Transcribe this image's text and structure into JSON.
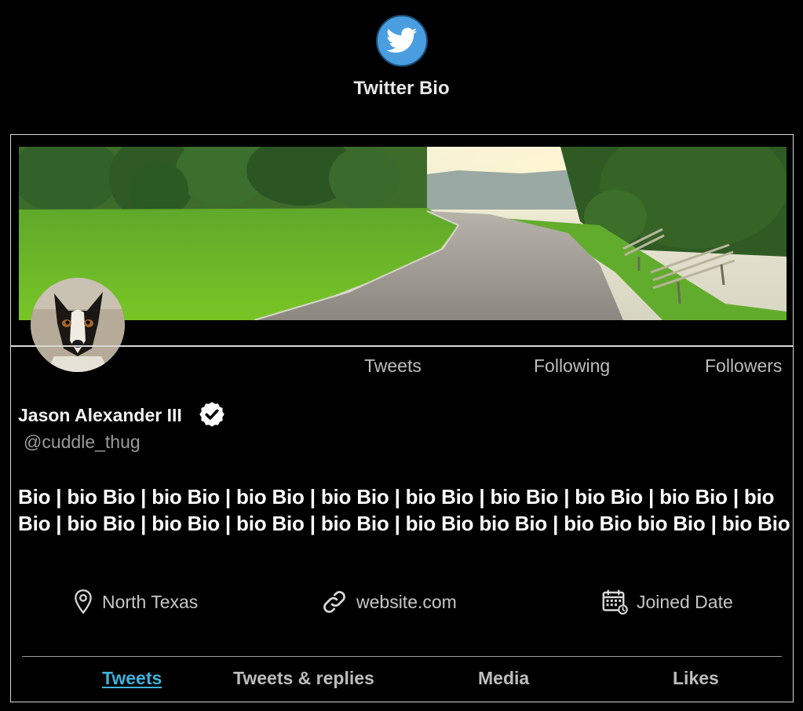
{
  "app": {
    "title": "Twitter Bio",
    "logo_icon": "twitter-bird-icon",
    "brand_color": "#4a9ee0"
  },
  "profile": {
    "display_name": "Jason Alexander III",
    "handle": "@cuddle_thug",
    "verified": true,
    "bio_lines": [
      "Bio | bio Bio | bio Bio | bio Bio | bio Bio | bio Bio | bio Bio | bio Bio | bio Bio | bio",
      "Bio | bio Bio | bio Bio | bio Bio | bio Bio | bio Bio bio Bio | bio Bio bio Bio | bio Bio"
    ],
    "banner_alt": "park-path-banner",
    "avatar_alt": "dog-avatar"
  },
  "stats": {
    "tweets_label": "Tweets",
    "following_label": "Following",
    "followers_label": "Followers"
  },
  "meta": {
    "location": "North Texas",
    "location_icon": "location-pin-icon",
    "website": "website.com",
    "website_icon": "link-icon",
    "joined": "Joined Date",
    "joined_icon": "calendar-icon"
  },
  "tabs": [
    {
      "label": "Tweets",
      "active": true
    },
    {
      "label": "Tweets & replies",
      "active": false
    },
    {
      "label": "Media",
      "active": false
    },
    {
      "label": "Likes",
      "active": false
    }
  ],
  "colors": {
    "background": "#000000",
    "accent": "#3db3dc",
    "muted_text": "#bdbdbd",
    "border": "#d8d8d8"
  }
}
